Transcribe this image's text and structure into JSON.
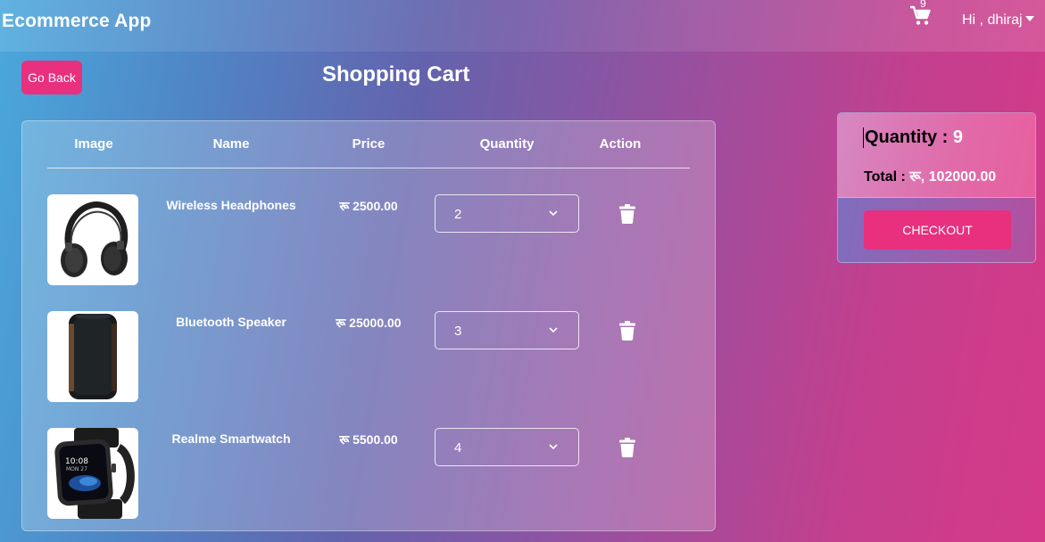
{
  "app": {
    "brand": "Ecommerce App"
  },
  "nav": {
    "cart_icon": "shopping-cart-icon",
    "cart_count": "9",
    "user_greeting": "Hi , dhiraj"
  },
  "page": {
    "go_back_label": "Go Back",
    "title": "Shopping Cart"
  },
  "table": {
    "headers": [
      "Image",
      "Name",
      "Price",
      "Quantity",
      "Action"
    ],
    "rows": [
      {
        "image": "headphones-image",
        "name": "Wireless Headphones",
        "price": "रू 2500.00",
        "quantity": "2",
        "action_icon": "trash-icon"
      },
      {
        "image": "speaker-image",
        "name": "Bluetooth Speaker",
        "price": "रू 25000.00",
        "quantity": "3",
        "action_icon": "trash-icon"
      },
      {
        "image": "smartwatch-image",
        "name": "Realme Smartwatch",
        "price": "रू 5500.00",
        "quantity": "4",
        "action_icon": "trash-icon"
      }
    ]
  },
  "summary": {
    "quantity_label": "Quantity : ",
    "quantity_value": "9",
    "total_label": "Total : ",
    "total_value": "रू, 102000.00",
    "checkout_label": "CHECKOUT"
  },
  "colors": {
    "accent": "#e8307f",
    "bg_start": "#4aa8dc",
    "bg_end": "#d53a87"
  }
}
